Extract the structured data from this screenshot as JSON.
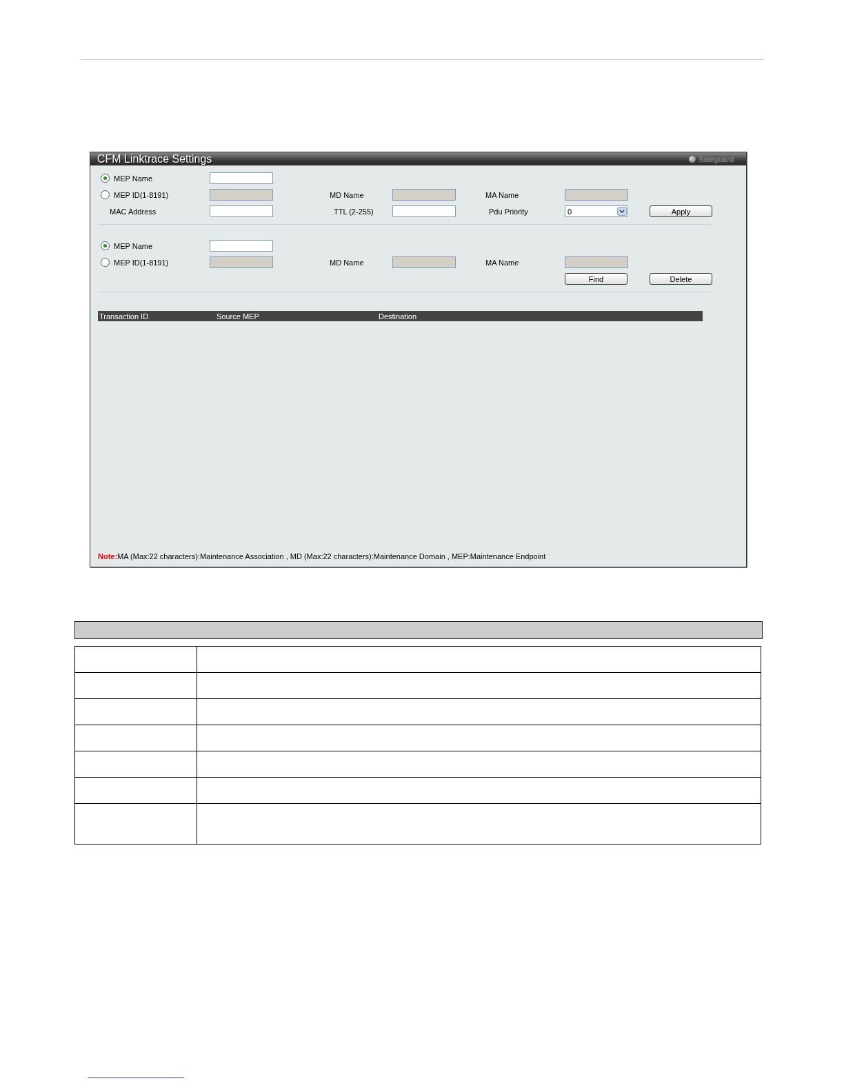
{
  "panel": {
    "title": "CFM Linktrace Settings",
    "safeguard": "Safeguard"
  },
  "linktrace_form": {
    "selector": [
      {
        "label": "MEP Name",
        "selected": true
      },
      {
        "label": "MEP ID(1-8191)",
        "selected": false
      }
    ],
    "md_label": "MD Name",
    "ma_label": "MA Name",
    "mac_label": "MAC Address",
    "ttl_label": "TTL (2-255)",
    "pdu_label": "Pdu Priority",
    "pdu_value": "0",
    "apply": "Apply"
  },
  "find_form": {
    "selector": [
      {
        "label": "MEP Name",
        "selected": true
      },
      {
        "label": "MEP ID(1-8191)",
        "selected": false
      }
    ],
    "md_label": "MD Name",
    "ma_label": "MA Name",
    "find": "Find",
    "delete": "Delete"
  },
  "results_table": {
    "columns": [
      "Transaction ID",
      "Source MEP",
      "Destination"
    ]
  },
  "note": {
    "prefix": "Note:",
    "text": "MA (Max:22 characters):Maintenance Association , MD (Max:22 characters):Maintenance Domain , MEP:Maintenance Endpoint"
  }
}
